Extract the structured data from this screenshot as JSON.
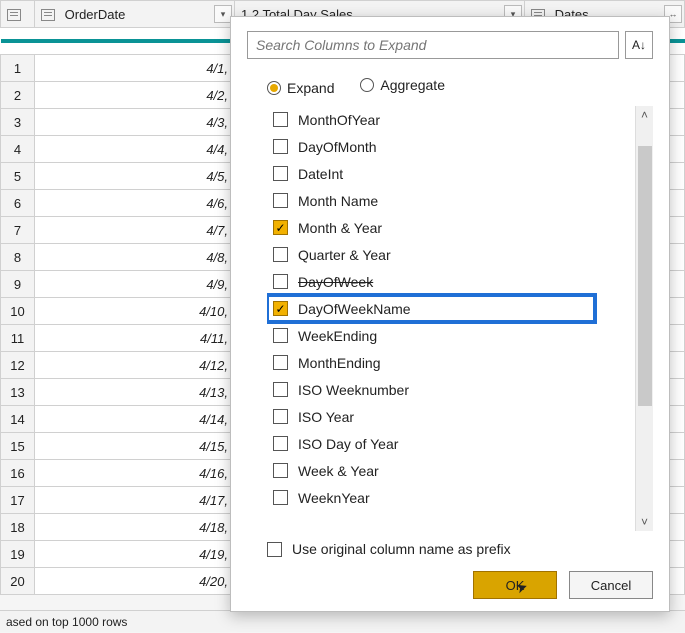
{
  "columns": {
    "orderDate": "OrderDate",
    "totalDaySales": "1.2  Total Day Sales",
    "dates": "Dates"
  },
  "rows": [
    {
      "n": "1",
      "date": "4/1,"
    },
    {
      "n": "2",
      "date": "4/2,"
    },
    {
      "n": "3",
      "date": "4/3,"
    },
    {
      "n": "4",
      "date": "4/4,"
    },
    {
      "n": "5",
      "date": "4/5,"
    },
    {
      "n": "6",
      "date": "4/6,"
    },
    {
      "n": "7",
      "date": "4/7,"
    },
    {
      "n": "8",
      "date": "4/8,"
    },
    {
      "n": "9",
      "date": "4/9,"
    },
    {
      "n": "10",
      "date": "4/10,"
    },
    {
      "n": "11",
      "date": "4/11,"
    },
    {
      "n": "12",
      "date": "4/12,"
    },
    {
      "n": "13",
      "date": "4/13,"
    },
    {
      "n": "14",
      "date": "4/14,"
    },
    {
      "n": "15",
      "date": "4/15,"
    },
    {
      "n": "16",
      "date": "4/16,"
    },
    {
      "n": "17",
      "date": "4/17,"
    },
    {
      "n": "18",
      "date": "4/18,"
    },
    {
      "n": "19",
      "date": "4/19,"
    },
    {
      "n": "20",
      "date": "4/20,"
    }
  ],
  "status": "ased on top 1000 rows",
  "popup": {
    "searchPlaceholder": "Search Columns to Expand",
    "sortGlyph": "A↓",
    "mode": {
      "expand": "Expand",
      "aggregate": "Aggregate"
    },
    "items": [
      {
        "label": "MonthOfYear",
        "checked": false,
        "hl": false
      },
      {
        "label": "DayOfMonth",
        "checked": false,
        "hl": false
      },
      {
        "label": "DateInt",
        "checked": false,
        "hl": false
      },
      {
        "label": "Month Name",
        "checked": false,
        "hl": false
      },
      {
        "label": "Month & Year",
        "checked": true,
        "hl": false
      },
      {
        "label": "Quarter & Year",
        "checked": false,
        "hl": false
      },
      {
        "label": "DayOfWeek",
        "checked": false,
        "hl": false,
        "strike": true
      },
      {
        "label": "DayOfWeekName",
        "checked": true,
        "hl": true
      },
      {
        "label": "WeekEnding",
        "checked": false,
        "hl": false
      },
      {
        "label": "MonthEnding",
        "checked": false,
        "hl": false
      },
      {
        "label": "ISO Weeknumber",
        "checked": false,
        "hl": false
      },
      {
        "label": "ISO Year",
        "checked": false,
        "hl": false
      },
      {
        "label": "ISO Day of Year",
        "checked": false,
        "hl": false
      },
      {
        "label": "Week & Year",
        "checked": false,
        "hl": false
      },
      {
        "label": "WeeknYear",
        "checked": false,
        "hl": false
      }
    ],
    "prefix": "Use original column name as prefix",
    "ok": "OK",
    "cancel": "Cancel"
  }
}
